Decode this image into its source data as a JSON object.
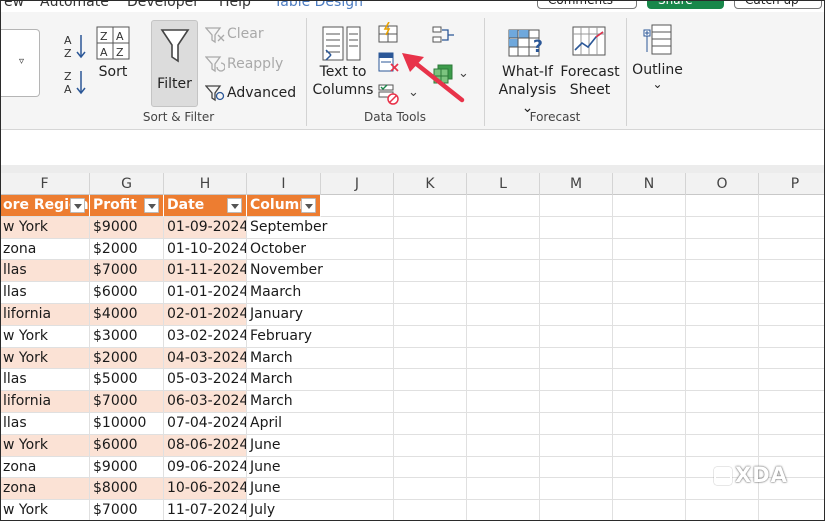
{
  "tabs": {
    "partial_1": "ew",
    "partial_2": "Automate",
    "partial_3": "Developer",
    "partial_4": "Help",
    "partial_5": "Table Design",
    "comments": "Comments",
    "share": "Share",
    "catchup": "Catch up"
  },
  "ribbon": {
    "sort_filter": {
      "group_label": "Sort & Filter",
      "sort_label": "Sort",
      "filter_label": "Filter",
      "clear_label": "Clear",
      "reapply_label": "Reapply",
      "advanced_label": "Advanced"
    },
    "data_tools": {
      "group_label": "Data Tools",
      "text_to_columns_line1": "Text to",
      "text_to_columns_line2": "Columns",
      "dropdown_glyph": "⌄"
    },
    "forecast": {
      "group_label": "Forecast",
      "whatif_line1": "What-If",
      "whatif_line2": "Analysis ⌄",
      "forecast_line1": "Forecast",
      "forecast_line2": "Sheet"
    },
    "outline": {
      "label": "Outline",
      "chevron": "⌄"
    }
  },
  "columns": [
    "F",
    "G",
    "H",
    "I",
    "J",
    "K",
    "L",
    "M",
    "N",
    "O",
    "P"
  ],
  "table": {
    "headers": [
      "ore Region",
      "Profit",
      "Date",
      "Columr"
    ],
    "rows": [
      [
        "w York",
        "$9000",
        "01-09-2024",
        "September"
      ],
      [
        "zona",
        "$2000",
        "01-10-2024",
        "October"
      ],
      [
        "llas",
        "$7000",
        "01-11-2024",
        "November"
      ],
      [
        "llas",
        "$6000",
        "01-01-2024",
        "Maarch"
      ],
      [
        "lifornia",
        "$4000",
        "02-01-2024",
        "January"
      ],
      [
        "w York",
        "$3000",
        "03-02-2024",
        "February"
      ],
      [
        "w York",
        "$2000",
        "04-03-2024",
        "March"
      ],
      [
        "llas",
        "$5000",
        "05-03-2024",
        "March"
      ],
      [
        "lifornia",
        "$7000",
        "06-03-2024",
        "March"
      ],
      [
        "llas",
        "$10000",
        "07-04-2024",
        "April"
      ],
      [
        "w York",
        "$6000",
        "08-06-2024",
        "June"
      ],
      [
        "zona",
        "$9000",
        "09-06-2024",
        "June"
      ],
      [
        "zona",
        "$8000",
        "10-06-2024",
        "June"
      ],
      [
        "w York",
        "$7000",
        "11-07-2024",
        "July"
      ]
    ]
  },
  "watermark": "XDA",
  "colors": {
    "header_orange": "#ed7d31",
    "band_peach": "#fbe2d5",
    "arrow_red": "#e8334a"
  }
}
